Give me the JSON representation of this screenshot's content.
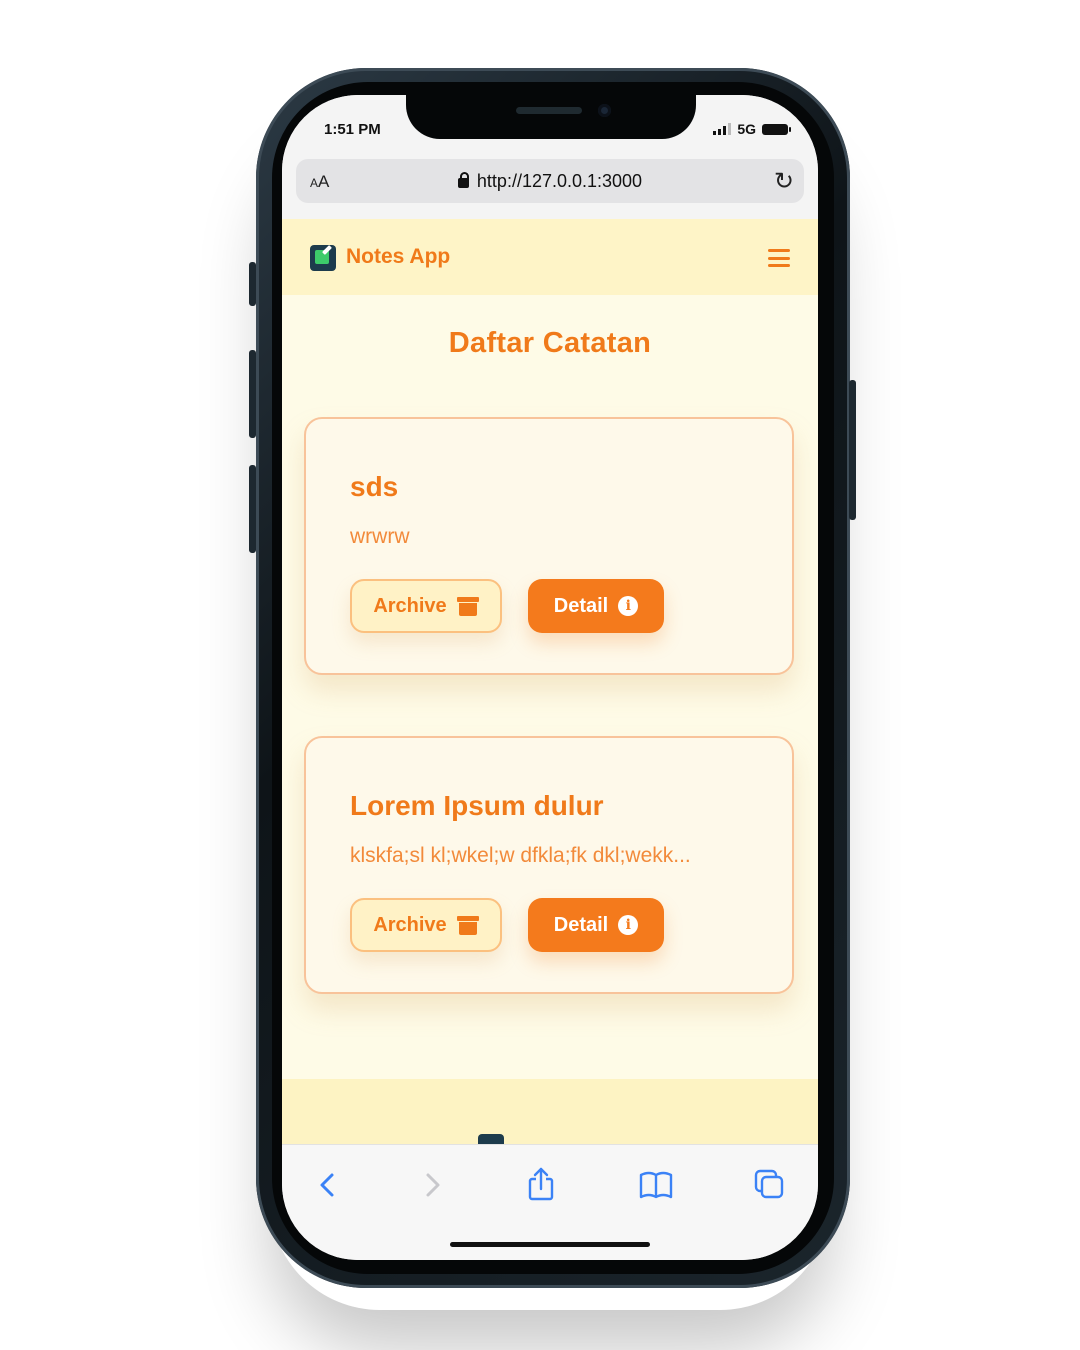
{
  "status_bar": {
    "time": "1:51 PM",
    "network": "5G"
  },
  "browser": {
    "text_size_label": "AA",
    "url": "http://127.0.0.1:3000"
  },
  "navbar": {
    "brand": "Notes App"
  },
  "page": {
    "title": "Daftar Catatan"
  },
  "notes": [
    {
      "title": "sds",
      "body": "wrwrw",
      "archive_label": "Archive",
      "detail_label": "Detail"
    },
    {
      "title": "Lorem Ipsum dulur",
      "body": "klskfa;sl kl;wkel;w dfkla;fk dkl;wekk...",
      "archive_label": "Archive",
      "detail_label": "Detail"
    }
  ],
  "colors": {
    "accent": "#f07a1a",
    "navbar_bg": "#fef4c7",
    "page_bg": "#fefbe7",
    "safari_blue": "#3b82f6"
  },
  "icons": {
    "navbar": [
      "notes-logo-icon",
      "hamburger-menu-icon"
    ],
    "card": [
      "archive-box-icon",
      "info-circle-icon"
    ],
    "safari_toolbar": [
      "back-arrow-icon",
      "forward-arrow-icon",
      "share-icon",
      "bookmarks-icon",
      "tabs-icon"
    ]
  }
}
